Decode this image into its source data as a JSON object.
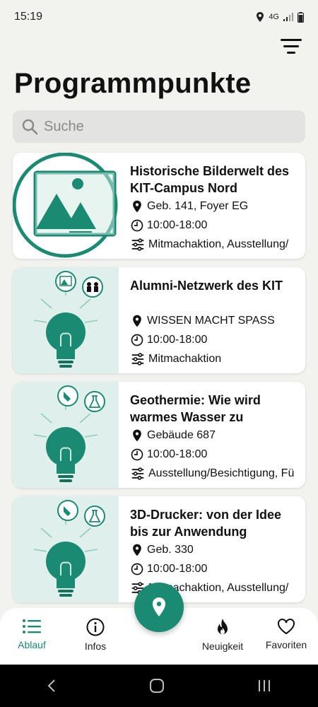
{
  "status": {
    "time": "15:19",
    "network": "4G"
  },
  "title": "Programmpunkte",
  "search": {
    "placeholder": "Suche"
  },
  "events": [
    {
      "title": " Historische Bilderwelt des KIT-Campus Nord",
      "location": "Geb. 141, Foyer EG",
      "time": "10:00-18:00",
      "tags": "Mitmachaktion, Ausstellung/"
    },
    {
      "title": "Alumni-Netzwerk des KIT",
      "location": "WISSEN MACHT SPASS",
      "time": "10:00-18:00",
      "tags": "Mitmachaktion"
    },
    {
      "title": "Geothermie: Wie wird warmes Wasser zu",
      "location": "Gebäude 687",
      "time": "10:00-18:00",
      "tags": "Ausstellung/Besichtigung, Fü"
    },
    {
      "title": " 3D-Drucker: von der Idee bis zur Anwendung",
      "location": "Geb. 330",
      "time": "10:00-18:00",
      "tags": "Mitmachaktion, Ausstellung/"
    }
  ],
  "nav": {
    "ablauf": "Ablauf",
    "infos": "Infos",
    "neuigkeit": "Neuigkeit",
    "favoriten": "Favoriten"
  },
  "colors": {
    "accent": "#1b8a72",
    "background": "#f2f2ef",
    "card": "#ffffff"
  }
}
